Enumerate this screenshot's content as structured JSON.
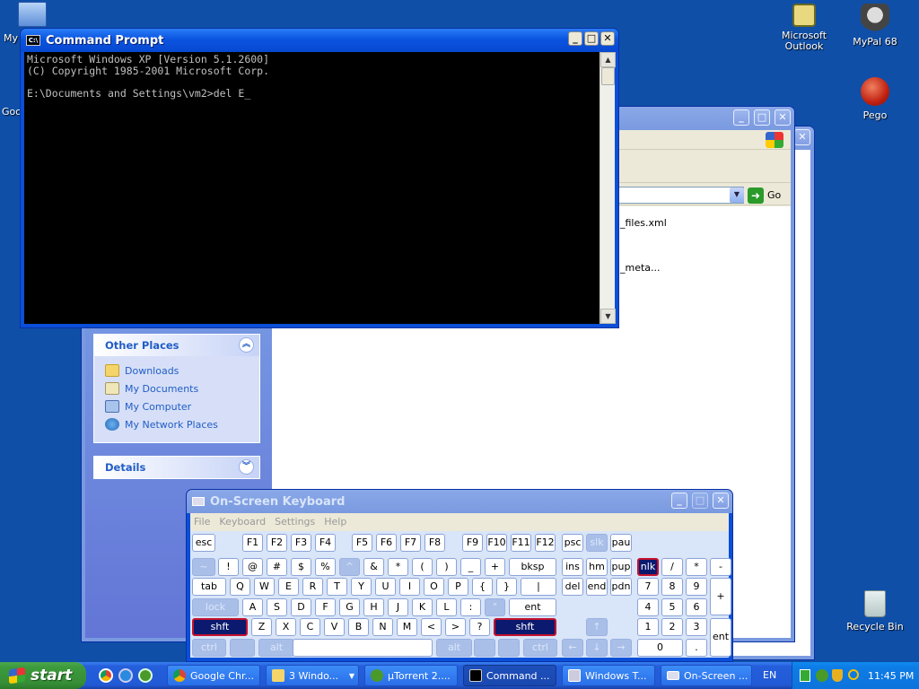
{
  "desktop": {
    "icons_left": [
      {
        "label": "My"
      },
      {
        "label": "Goo"
      }
    ],
    "icons_right": [
      {
        "label": "Microsoft Outlook",
        "icon": "outlook-icon"
      },
      {
        "label": "MyPal 68",
        "icon": "mypal-icon"
      },
      {
        "label": "Pego",
        "icon": "pego-icon"
      },
      {
        "label": "Recycle Bin",
        "icon": "recycle-bin-icon"
      }
    ]
  },
  "cmd": {
    "title": "Command Prompt",
    "lines": [
      "Microsoft Windows XP [Version 5.1.2600]",
      "(C) Copyright 1985-2001 Microsoft Corp.",
      "",
      "E:\\Documents and Settings\\vm2>del E_"
    ]
  },
  "explorer": {
    "go_label": "Go",
    "files": [
      "_files.xml",
      "_meta..."
    ],
    "other_places": {
      "title": "Other Places",
      "items": [
        "Downloads",
        "My Documents",
        "My Computer",
        "My Network Places"
      ]
    },
    "details": {
      "title": "Details"
    }
  },
  "osk": {
    "title": "On-Screen Keyboard",
    "menu": [
      "File",
      "Keyboard",
      "Settings",
      "Help"
    ]
  },
  "taskbar": {
    "start_label": "start",
    "items": [
      "Google Chr...",
      "3 Windo...",
      "µTorrent 2....",
      "Command ...",
      "Windows T...",
      "On-Screen ..."
    ],
    "language": "EN",
    "clock": "11:45 PM"
  },
  "colors": {
    "xp_blue": "#0b4fd8",
    "desktop": "#0f4fa8",
    "taskbar": "#245edb",
    "start_green": "#3c9a3c",
    "active_key_border": "#c4122e"
  }
}
